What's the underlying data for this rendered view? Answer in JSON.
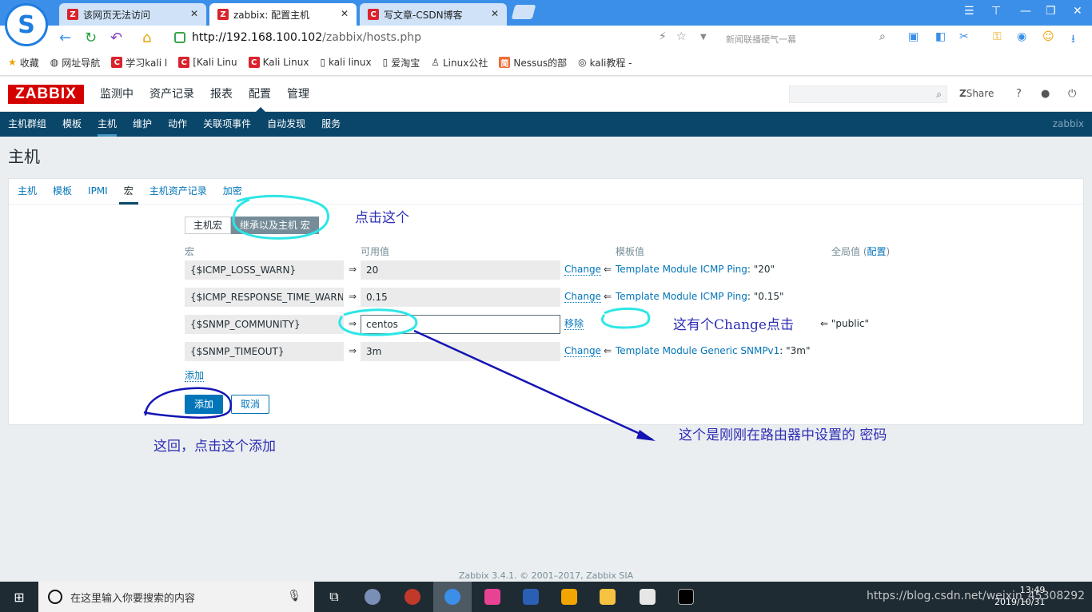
{
  "browser": {
    "tabs": [
      {
        "label": "该网页无法访问",
        "icon": "Z"
      },
      {
        "label": "zabbix: 配置主机",
        "icon": "Z"
      },
      {
        "label": "写文章-CSDN博客",
        "icon": "C"
      }
    ],
    "url_host": "http://192.168.100.102",
    "url_path": "/zabbix/hosts.php",
    "search_hint": "新闻联播硬气一幕",
    "bookmarks": [
      "收藏",
      "网址导航",
      "学习kali l",
      "[Kali Linu",
      "Kali Linux",
      "kali linux",
      "爱淘宝",
      "Linux公社",
      "Nessus的部",
      "kali教程 -"
    ]
  },
  "zabbix": {
    "logo": "ZABBIX",
    "top_menu": [
      "监测中",
      "资产记录",
      "报表",
      "配置",
      "管理"
    ],
    "share": "Share",
    "help": "?",
    "sub_menu": [
      "主机群组",
      "模板",
      "主机",
      "维护",
      "动作",
      "关联项事件",
      "自动发现",
      "服务"
    ],
    "server_name": "zabbix",
    "page_title": "主机",
    "form_tabs": [
      "主机",
      "模板",
      "IPMI",
      "宏",
      "主机资产记录",
      "加密"
    ],
    "macro_modes": [
      "主机宏",
      "继承以及主机 宏"
    ],
    "columns": {
      "macro": "宏",
      "effective": "可用值",
      "template": "模板值",
      "global": "全局值 (",
      "global_link": "配置",
      "global_end": ")"
    },
    "macros": [
      {
        "name": "{$ICMP_LOSS_WARN}",
        "value": "20",
        "action": "Change",
        "template": "Template Module ICMP Ping",
        "template_value": ": \"20\"",
        "global": ""
      },
      {
        "name": "{$ICMP_RESPONSE_TIME_WARN}",
        "value": "0.15",
        "action": "Change",
        "template": "Template Module ICMP Ping",
        "template_value": ": \"0.15\"",
        "global": ""
      },
      {
        "name": "{$SNMP_COMMUNITY}",
        "value": "centos",
        "action": "移除",
        "template": "",
        "template_value": "",
        "global": "\"public\""
      },
      {
        "name": "{$SNMP_TIMEOUT}",
        "value": "3m",
        "action": "Change",
        "template": "Template Module Generic SNMPv1",
        "template_value": ": \"3m\"",
        "global": ""
      }
    ],
    "add_link": "添加",
    "add_button": "添加",
    "cancel_button": "取消",
    "footer": "Zabbix 3.4.1. © 2001–2017, Zabbix SIA"
  },
  "annotations": {
    "click_this": "点击这个",
    "change_note": "这有个Change点击",
    "password_note": "这个是刚刚在路由器中设置的  密码",
    "add_note": "这回，点击这个添加"
  },
  "taskbar": {
    "search_placeholder": "在这里输入你要搜索的内容",
    "tray": "https://blog.csdn.net/weixin_45308292",
    "time": "13:49",
    "date": "2019/10/31"
  }
}
